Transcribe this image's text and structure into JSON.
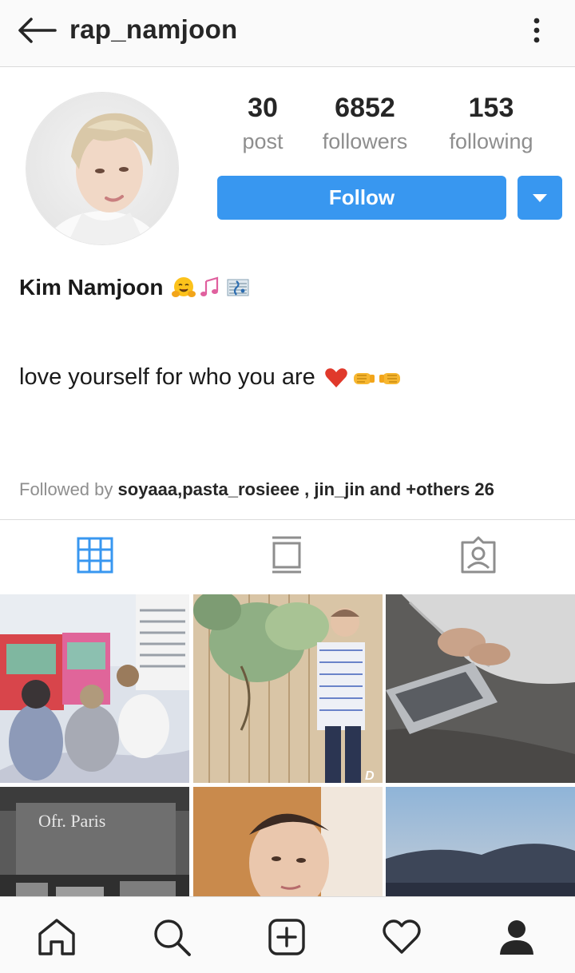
{
  "header": {
    "username": "rap_namjoon",
    "back_icon": "arrow-left-icon",
    "more_icon": "more-vertical-icon"
  },
  "profile": {
    "avatar_icon": "profile-photo",
    "stats": {
      "posts": {
        "value": "30",
        "label": "post"
      },
      "followers": {
        "value": "6852",
        "label": "followers"
      },
      "following": {
        "value": "153",
        "label": "following"
      }
    },
    "follow_label": "Follow",
    "full_name": "Kim Namjoon",
    "name_emojis": [
      "hugging-face-emoji",
      "musical-notes-emoji",
      "musical-score-emoji"
    ],
    "bio": "love yourself for who you are",
    "bio_emojis": [
      "red-heart-emoji",
      "left-facing-fist-emoji",
      "right-facing-fist-emoji"
    ],
    "followed_by": {
      "prefix": "Followed by",
      "names": "soyaaa,pasta_rosieee , jin_jin and +others 26"
    }
  },
  "tabs": [
    {
      "icon": "grid-icon",
      "active": true
    },
    {
      "icon": "feed-icon",
      "active": false
    },
    {
      "icon": "tagged-icon",
      "active": false
    }
  ],
  "grid": {
    "tiles": [
      {
        "icon": "photo-arcade"
      },
      {
        "icon": "photo-mural"
      },
      {
        "icon": "photo-laptop"
      },
      {
        "icon": "photo-bookstore"
      },
      {
        "icon": "photo-portrait"
      },
      {
        "icon": "photo-sunset"
      }
    ],
    "tile_texts": {
      "bookstore_sign": "Ofr. Paris",
      "mural_corner": "D"
    }
  },
  "bottom_nav": [
    "home-icon",
    "search-icon",
    "add-post-icon",
    "heart-icon",
    "profile-icon"
  ],
  "colors": {
    "accent": "#3897f0",
    "text": "#262626",
    "muted": "#8e8e8e",
    "divider": "#dbdbdb"
  }
}
